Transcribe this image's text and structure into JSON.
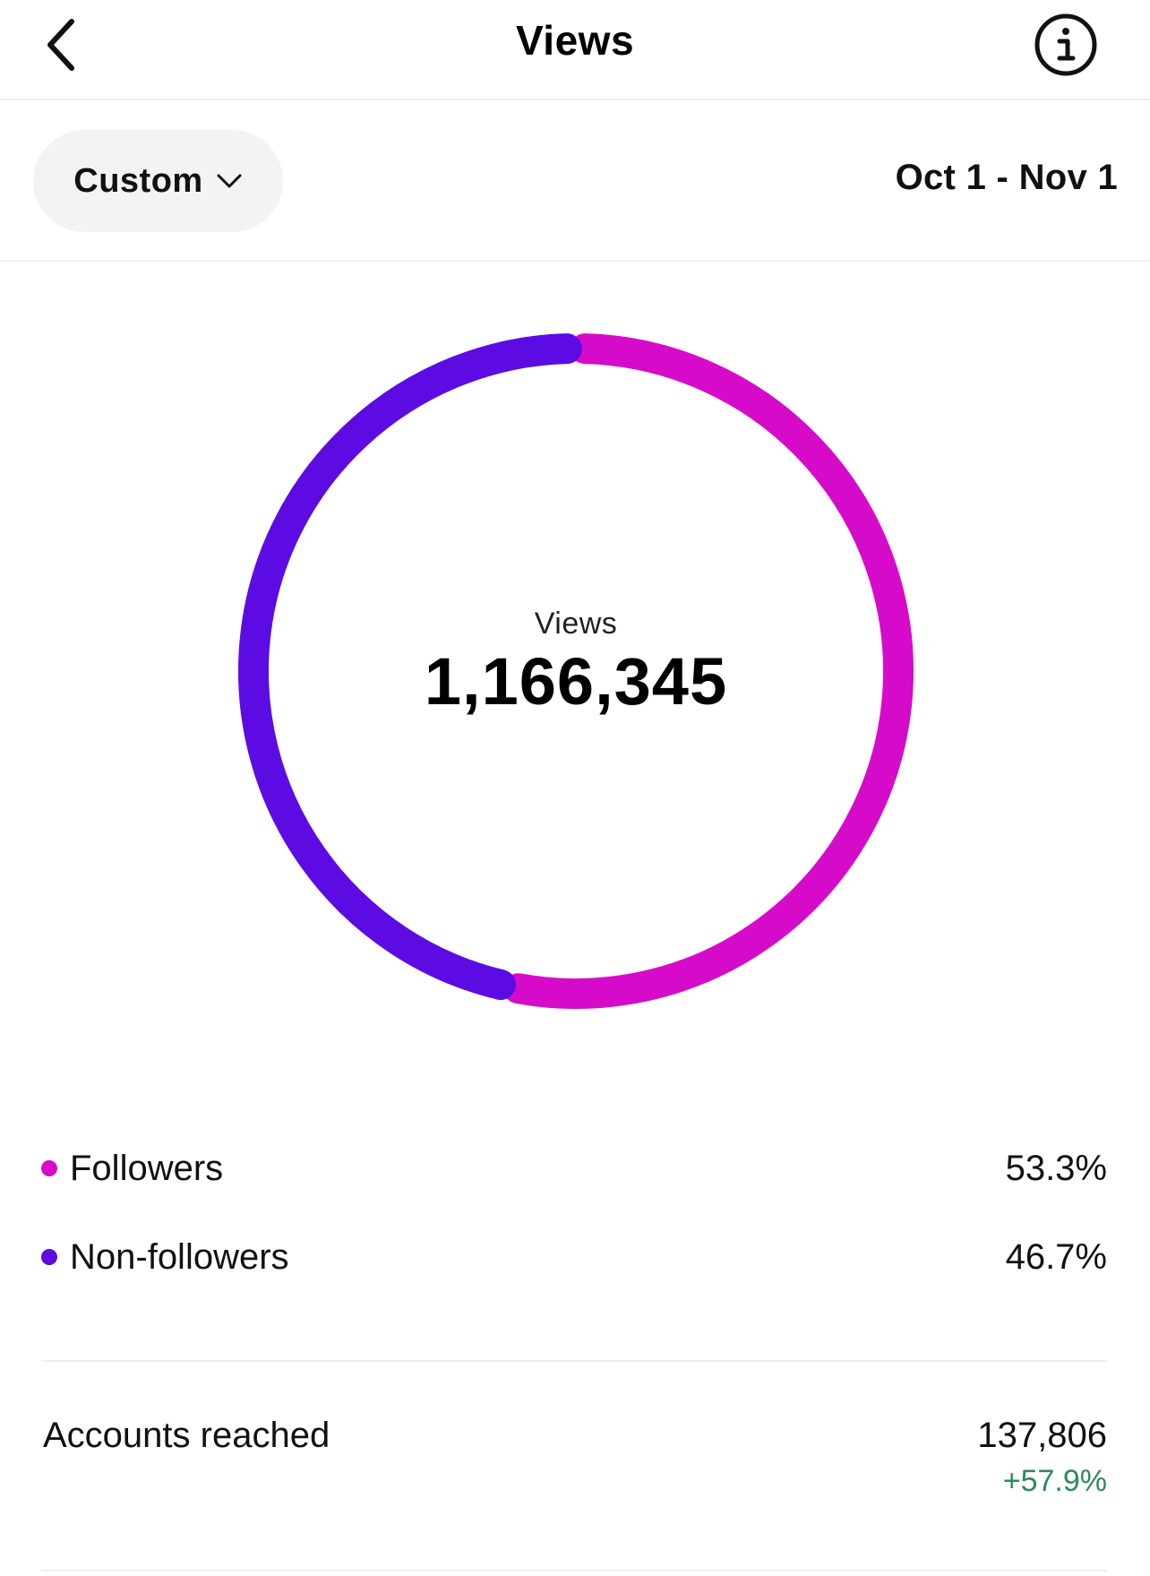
{
  "header": {
    "title": "Views",
    "back_icon": "chevron-left-icon",
    "info_icon": "info-icon"
  },
  "range": {
    "selected": "Custom",
    "dropdown_icon": "chevron-down-icon",
    "dates": "Oct 1 - Nov 1"
  },
  "donut": {
    "label": "Views",
    "total": "1,166,345"
  },
  "breakdown": [
    {
      "label": "Followers",
      "value": "53.3%",
      "color": "#d60bc9"
    },
    {
      "label": "Non-followers",
      "value": "46.7%",
      "color": "#5c0ce3"
    }
  ],
  "accounts_reached": {
    "label": "Accounts reached",
    "value": "137,806",
    "change": "+57.9%",
    "change_color": "#2e8b57"
  },
  "chart_data": {
    "type": "pie",
    "categories": [
      "Followers",
      "Non-followers"
    ],
    "values": [
      53.3,
      46.7
    ],
    "colors": [
      "#d60bc9",
      "#5c0ce3"
    ],
    "title": "Views",
    "center_value": "1,166,345"
  }
}
